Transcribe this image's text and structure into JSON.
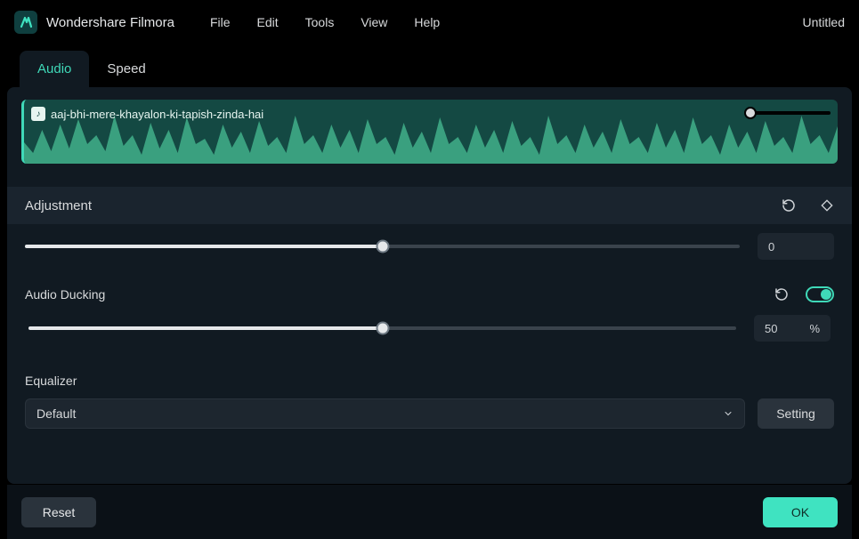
{
  "app": {
    "name": "Wondershare Filmora",
    "doc_title": "Untitled"
  },
  "menubar": {
    "items": [
      "File",
      "Edit",
      "Tools",
      "View",
      "Help"
    ]
  },
  "tabs": {
    "audio": "Audio",
    "speed": "Speed",
    "active": "audio"
  },
  "clip": {
    "name": "aaj-bhi-mere-khayalon-ki-tapish-zinda-hai"
  },
  "adjustment": {
    "title": "Adjustment",
    "pitch": {
      "value": 0,
      "percent": 50
    }
  },
  "ducking": {
    "label": "Audio Ducking",
    "value": 50,
    "unit": "%",
    "enabled": true,
    "percent": 50
  },
  "equalizer": {
    "label": "Equalizer",
    "selected": "Default",
    "setting_btn": "Setting"
  },
  "footer": {
    "reset": "Reset",
    "ok": "OK"
  }
}
